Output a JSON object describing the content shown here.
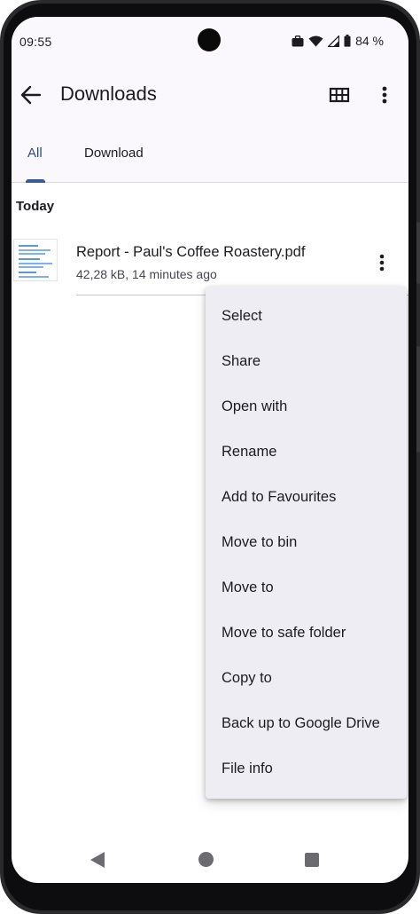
{
  "status_bar": {
    "time": "09:55",
    "battery": "84 %"
  },
  "app_bar": {
    "title": "Downloads"
  },
  "tabs": [
    {
      "label": "All",
      "selected": true
    },
    {
      "label": "Download",
      "selected": false
    }
  ],
  "section": {
    "title": "Today"
  },
  "file": {
    "name": "Report - Paul's Coffee Roastery.pdf",
    "meta": "42,28 kB, 14 minutes ago"
  },
  "menu": {
    "items": [
      "Select",
      "Share",
      "Open with",
      "Rename",
      "Add to Favourites",
      "Move to bin",
      "Move to",
      "Move to safe folder",
      "Copy to",
      "Back up to Google Drive",
      "File info"
    ]
  },
  "colors": {
    "accent": "#3a5a9b",
    "surface": "#fbf8fd",
    "menu_bg": "#eeedf3"
  }
}
